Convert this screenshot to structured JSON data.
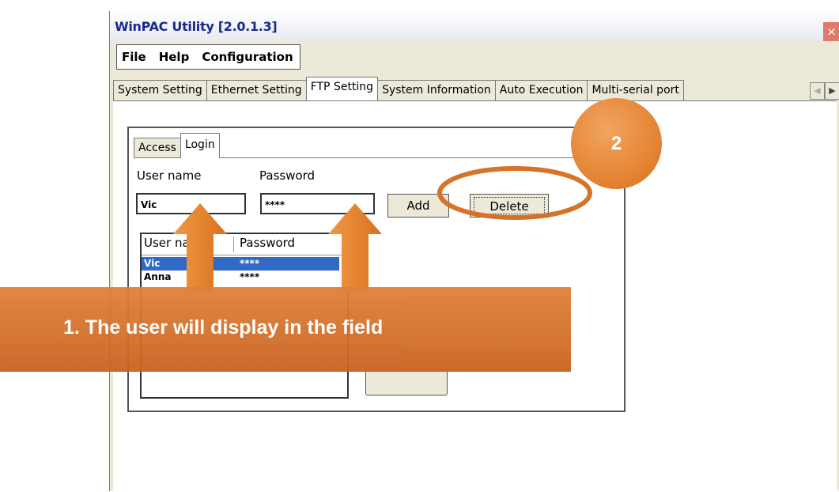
{
  "window": {
    "title": "WinPAC Utility [2.0.1.3]",
    "close_glyph": "×"
  },
  "menu": [
    "File",
    "Help",
    "Configuration"
  ],
  "tabs": [
    "System Setting",
    "Ethernet Setting",
    "FTP Setting",
    "System Information",
    "Auto Execution",
    "Multi-serial port"
  ],
  "active_tab": "FTP Setting",
  "tab_arrows": {
    "left": "◀",
    "right": "▶"
  },
  "ftp": {
    "subtabs": [
      "Access",
      "Login"
    ],
    "active_subtab": "Login",
    "user_name_label": "User name",
    "password_label": "Password",
    "user_name_value": "Vic",
    "password_value": "****",
    "add_label": "Add",
    "delete_label": "Delete",
    "list": {
      "columns": [
        "User name",
        "Password"
      ],
      "rows": [
        {
          "user": "Vic",
          "password": "****",
          "selected": true
        },
        {
          "user": "Anna",
          "password": "****",
          "selected": false
        }
      ]
    }
  },
  "annotations": {
    "callout_text": "1. The user will display in the field",
    "step_number": "2",
    "color": "#e07a2e"
  }
}
